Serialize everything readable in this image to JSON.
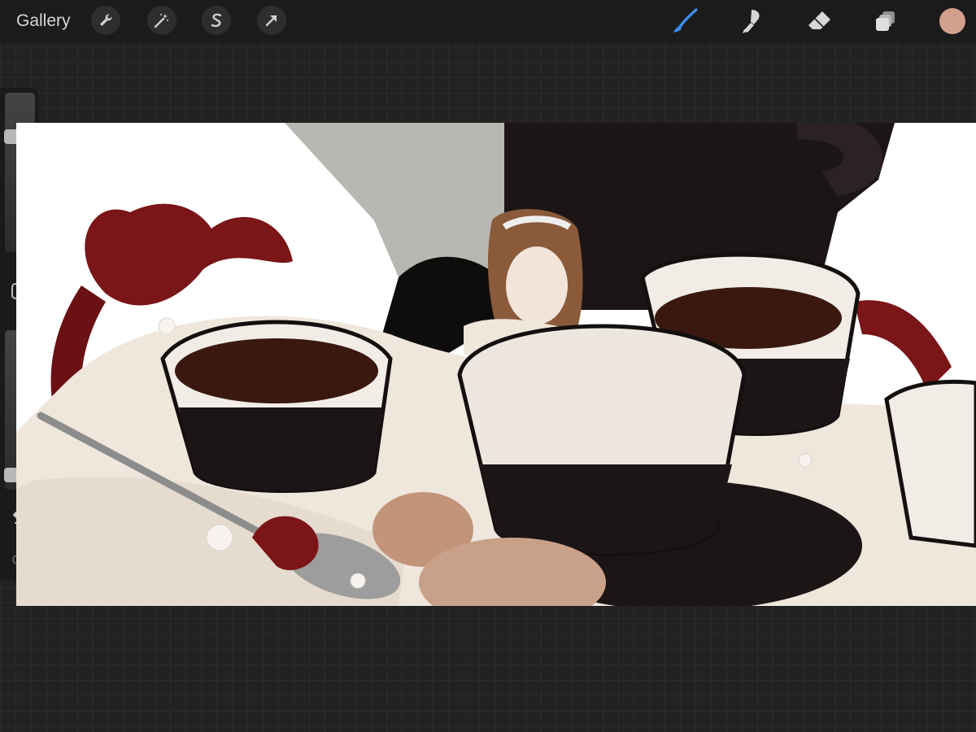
{
  "app": {
    "gallery_label": "Gallery"
  },
  "toolbar": {
    "left_tools": [
      {
        "name": "wrench-icon"
      },
      {
        "name": "magic-wand-icon"
      },
      {
        "name": "selection-s-icon"
      },
      {
        "name": "arrow-move-icon"
      }
    ],
    "right_tools": [
      {
        "name": "brush-icon",
        "active": true
      },
      {
        "name": "smudge-icon",
        "active": false
      },
      {
        "name": "eraser-icon",
        "active": false
      },
      {
        "name": "layers-icon",
        "active": false
      }
    ],
    "current_color": "#d4a08e",
    "active_color": "#3b8cf0"
  },
  "sidebar": {
    "brush_size": 0.75,
    "brush_opacity": 0.05,
    "undo": "undo-icon",
    "redo": "redo-icon"
  },
  "colors": {
    "ui_bg": "#1b1b1b",
    "icon": "#cfcfcf",
    "canvas": "#ffffff"
  }
}
